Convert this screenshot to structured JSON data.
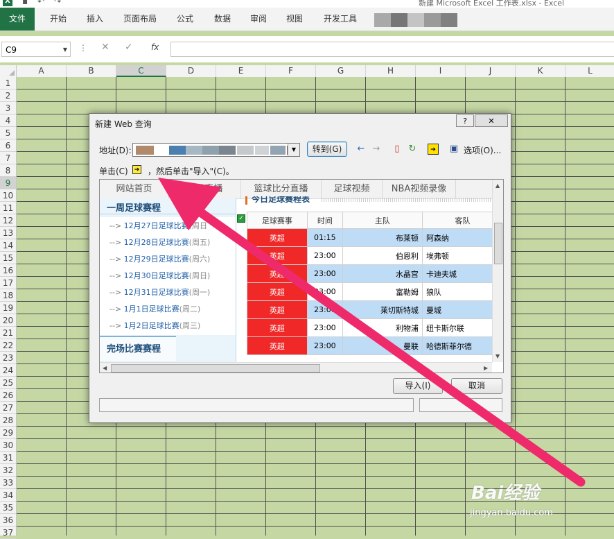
{
  "window": {
    "title": "新建 Microsoft Excel 工作表.xlsx - Excel"
  },
  "ribbon": {
    "file": "文件",
    "tabs": [
      "开始",
      "插入",
      "页面布局",
      "公式",
      "数据",
      "审阅",
      "视图",
      "开发工具"
    ]
  },
  "formula_bar": {
    "name_box": "C9",
    "cancel": "✕",
    "enter": "✓",
    "fx": "fx",
    "value": ""
  },
  "grid": {
    "columns": [
      "A",
      "B",
      "C",
      "D",
      "E",
      "F",
      "G",
      "H",
      "I",
      "J",
      "K",
      "L"
    ],
    "rows": [
      "1",
      "2",
      "3",
      "4",
      "5",
      "6",
      "7",
      "8",
      "9",
      "10",
      "11",
      "12",
      "13",
      "14",
      "15",
      "16",
      "17",
      "18",
      "19",
      "20",
      "21",
      "22",
      "23",
      "24",
      "25",
      "26",
      "27",
      "28",
      "29",
      "30",
      "31",
      "32",
      "33",
      "34",
      "35",
      "36",
      "37"
    ],
    "selected_column": "C",
    "selected_row": "9"
  },
  "dialog": {
    "title": "新建 Web 查询",
    "help": "?",
    "close": "✕",
    "address_label": "地址(D):",
    "goto_button": "转到(G)",
    "options_button": "选项(O)...",
    "instruction_prefix": "单击(C)",
    "instruction_suffix": "，然后单击\"导入\"(C)。",
    "import_button": "导入(I)",
    "cancel_button": "取消",
    "colors": {
      "league_bg": "#f02828",
      "alt_row": "#bfdcf6",
      "accent": "#1f4e79"
    }
  },
  "web": {
    "nav": [
      "网站首页",
      "比分直播",
      "篮球比分直播",
      "足球视频",
      "NBA视频录像"
    ],
    "sidebar": {
      "title": "一周足球赛程",
      "items": [
        {
          "prefix": "-->",
          "text": "12月27日足球比赛",
          "week": "(周日"
        },
        {
          "prefix": "-->",
          "text": "12月28日足球比赛",
          "week": "(周五)"
        },
        {
          "prefix": "-->",
          "text": "12月29日足球比赛",
          "week": "(周六)"
        },
        {
          "prefix": "-->",
          "text": "12月30日足球比赛",
          "week": "(周日)"
        },
        {
          "prefix": "-->",
          "text": "12月31日足球比赛",
          "week": "(周一)"
        },
        {
          "prefix": "-->",
          "text": "1月1日足球比赛",
          "week": "(周二)"
        },
        {
          "prefix": "-->",
          "text": "1月2日足球比赛",
          "week": "(周三)"
        }
      ],
      "tab": "完场比赛赛程"
    },
    "main_title": "今日足球赛程表",
    "table": {
      "headers": [
        "足球赛事",
        "时间",
        "主队",
        "客队"
      ],
      "rows": [
        [
          "英超",
          "01:15",
          "布莱顿",
          "阿森纳"
        ],
        [
          "英超",
          "23:00",
          "伯恩利",
          "埃弗顿"
        ],
        [
          "英超",
          "23:00",
          "水晶宫",
          "卡迪夫城"
        ],
        [
          "英超",
          "23:00",
          "富勒姆",
          "狼队"
        ],
        [
          "英超",
          "23:00",
          "莱切斯特城",
          "曼城"
        ],
        [
          "英超",
          "23:00",
          "利物浦",
          "纽卡斯尔联"
        ],
        [
          "英超",
          "23:00",
          "曼联",
          "哈德斯菲尔德"
        ]
      ]
    }
  },
  "watermark": {
    "logo": "Bai经验",
    "url": "jingyan.baidu.com"
  }
}
